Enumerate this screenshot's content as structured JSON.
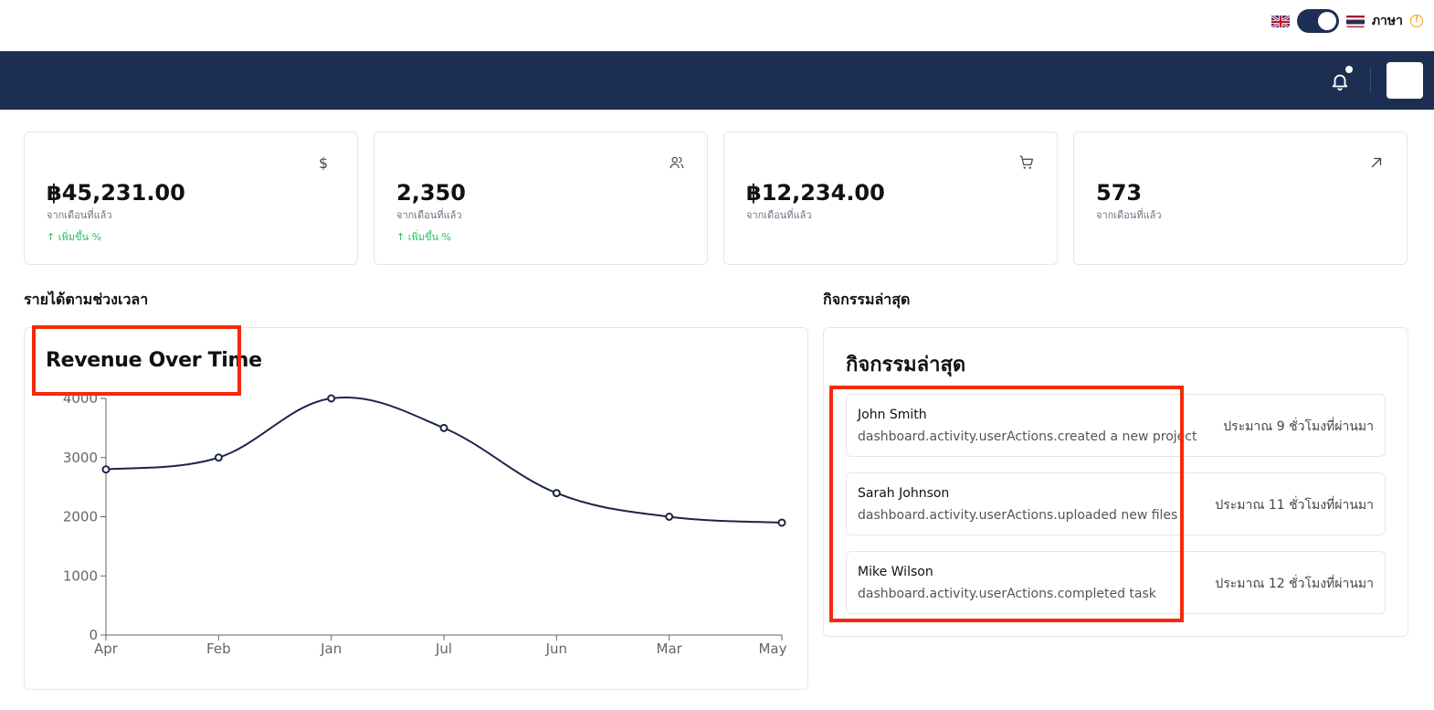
{
  "language": {
    "label": "ภาษา",
    "warning_symbol": "!"
  },
  "header": {
    "notification_icon": "bell-icon"
  },
  "stats": [
    {
      "icon": "dollar-icon",
      "icon_glyph": "$",
      "value": "฿45,231.00",
      "sub": "จากเดือนที่แล้ว",
      "trend": "↑ เพิ่มขึ้น %"
    },
    {
      "icon": "users-icon",
      "value": "2,350",
      "sub": "จากเดือนที่แล้ว",
      "trend": "↑ เพิ่มขึ้น %"
    },
    {
      "icon": "cart-icon",
      "value": "฿12,234.00",
      "sub": "จากเดือนที่แล้ว"
    },
    {
      "icon": "arrow-up-right-icon",
      "value": "573",
      "sub": "จากเดือนที่แล้ว"
    }
  ],
  "revenue_section": {
    "heading": "รายได้ตามช่วงเวลา"
  },
  "activity_section": {
    "heading": "กิจกรรมล่าสุด",
    "card_title": "กิจกรรมล่าสุด"
  },
  "activities": [
    {
      "name": "John Smith",
      "action": "dashboard.activity.userActions.created a new project",
      "time": "ประมาณ 9 ชั่วโมงที่ผ่านมา"
    },
    {
      "name": "Sarah Johnson",
      "action": "dashboard.activity.userActions.uploaded new files",
      "time": "ประมาณ 11 ชั่วโมงที่ผ่านมา"
    },
    {
      "name": "Mike Wilson",
      "action": "dashboard.activity.userActions.completed task",
      "time": "ประมาณ 12 ชั่วโมงที่ผ่านมา"
    }
  ],
  "chart_data": {
    "type": "line",
    "title": "Revenue Over Time",
    "categories": [
      "Apr",
      "Feb",
      "Jan",
      "Jul",
      "Jun",
      "Mar",
      "May"
    ],
    "values": [
      2800,
      3000,
      4000,
      3500,
      2400,
      2000,
      1900
    ],
    "yticks": [
      0,
      1000,
      2000,
      3000,
      4000
    ],
    "ylim": [
      0,
      4000
    ],
    "line_color": "#1c2548",
    "grid": false
  },
  "colors": {
    "navy": "#1c2f52",
    "trend_up": "#22c55e",
    "highlight": "#f52a0a"
  }
}
